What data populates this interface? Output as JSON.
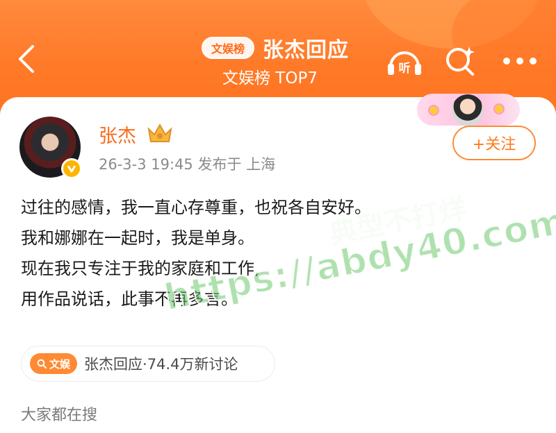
{
  "header": {
    "tag": "文娱榜",
    "title": "张杰回应",
    "subtitle": "文娱榜 TOP7",
    "listen_label": "听",
    "icons": [
      "chevron-left-icon",
      "headphones-icon",
      "search-sparkle-icon",
      "more-icon"
    ]
  },
  "post": {
    "username": "张杰",
    "meta": "26-3-3 19:45  发布于 上海",
    "follow_label": "+关注",
    "lines": [
      "过往的感情，我一直心存尊重，也祝各自安好。",
      "我和娜娜在一起时，我是单身。",
      "现在我只专注于我的家庭和工作,",
      "用作品说话，此事不再多言。"
    ]
  },
  "topic": {
    "badge": "文娱",
    "text": "张杰回应·74.4万新讨论"
  },
  "section_label": "大家都在搜",
  "watermark": {
    "line1": "典型不打烊",
    "line2": "https://abdy40.com"
  },
  "colors": {
    "header_orange": "#ff7a28",
    "accent": "#f96a1a",
    "verified": "#ffb400"
  }
}
